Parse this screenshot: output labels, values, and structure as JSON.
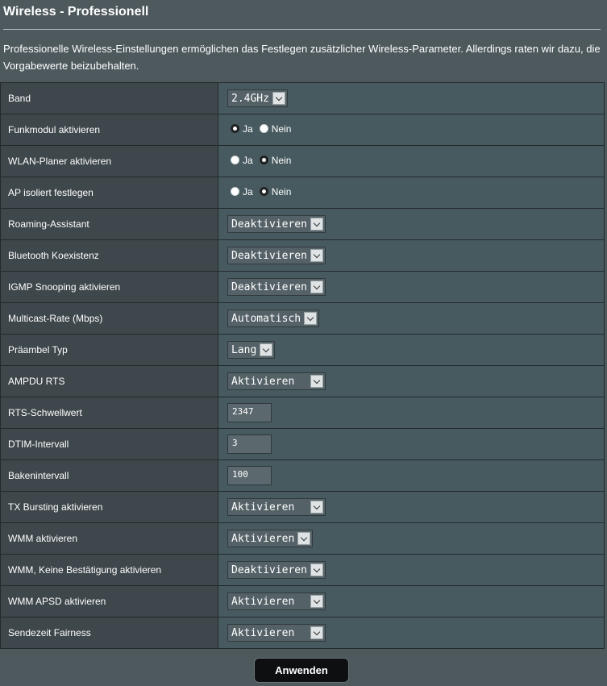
{
  "header": {
    "title": "Wireless - Professionell",
    "description": "Professionelle Wireless-Einstellungen ermöglichen das Festlegen zusätzlicher Wireless-Parameter. Allerdings raten wir dazu, die Vorgabewerte beizubehalten."
  },
  "rows": {
    "band": {
      "label": "Band",
      "value": "2.4GHz"
    },
    "radio_enable": {
      "label": "Funkmodul aktivieren",
      "opt_yes": "Ja",
      "opt_no": "Nein",
      "selected": "Ja"
    },
    "wlan_scheduler": {
      "label": "WLAN-Planer aktivieren",
      "opt_yes": "Ja",
      "opt_no": "Nein",
      "selected": "Nein"
    },
    "ap_isolated": {
      "label": "AP isoliert festlegen",
      "opt_yes": "Ja",
      "opt_no": "Nein",
      "selected": "Nein"
    },
    "roaming": {
      "label": "Roaming-Assistant",
      "value": "Deaktivieren"
    },
    "bluetooth": {
      "label": "Bluetooth Koexistenz",
      "value": "Deaktivieren"
    },
    "igmp": {
      "label": "IGMP Snooping aktivieren",
      "value": "Deaktivieren"
    },
    "multicast": {
      "label": "Multicast-Rate (Mbps)",
      "value": "Automatisch"
    },
    "preamble": {
      "label": "Präambel Typ",
      "value": "Lang"
    },
    "ampdu_rts": {
      "label": "AMPDU RTS",
      "value": "Aktivieren"
    },
    "rts_threshold": {
      "label": "RTS-Schwellwert",
      "value": "2347"
    },
    "dtim": {
      "label": "DTIM-Intervall",
      "value": "3"
    },
    "beacon": {
      "label": "Bakenintervall",
      "value": "100"
    },
    "tx_bursting": {
      "label": "TX Bursting aktivieren",
      "value": "Aktivieren"
    },
    "wmm": {
      "label": "WMM aktivieren",
      "value": "Aktivieren"
    },
    "wmm_noack": {
      "label": "WMM, Keine Bestätigung aktivieren",
      "value": "Deaktivieren"
    },
    "wmm_apsd": {
      "label": "WMM APSD aktivieren",
      "value": "Aktivieren"
    },
    "airtime": {
      "label": "Sendezeit Fairness",
      "value": "Aktivieren"
    }
  },
  "actions": {
    "apply_label": "Anwenden"
  },
  "icons": {
    "select_arrow": "chevron-down-icon"
  },
  "colors": {
    "background": "#4d595d",
    "label_cell": "#3e474b",
    "value_cell": "#475a5f",
    "button": "#0d0f10"
  }
}
